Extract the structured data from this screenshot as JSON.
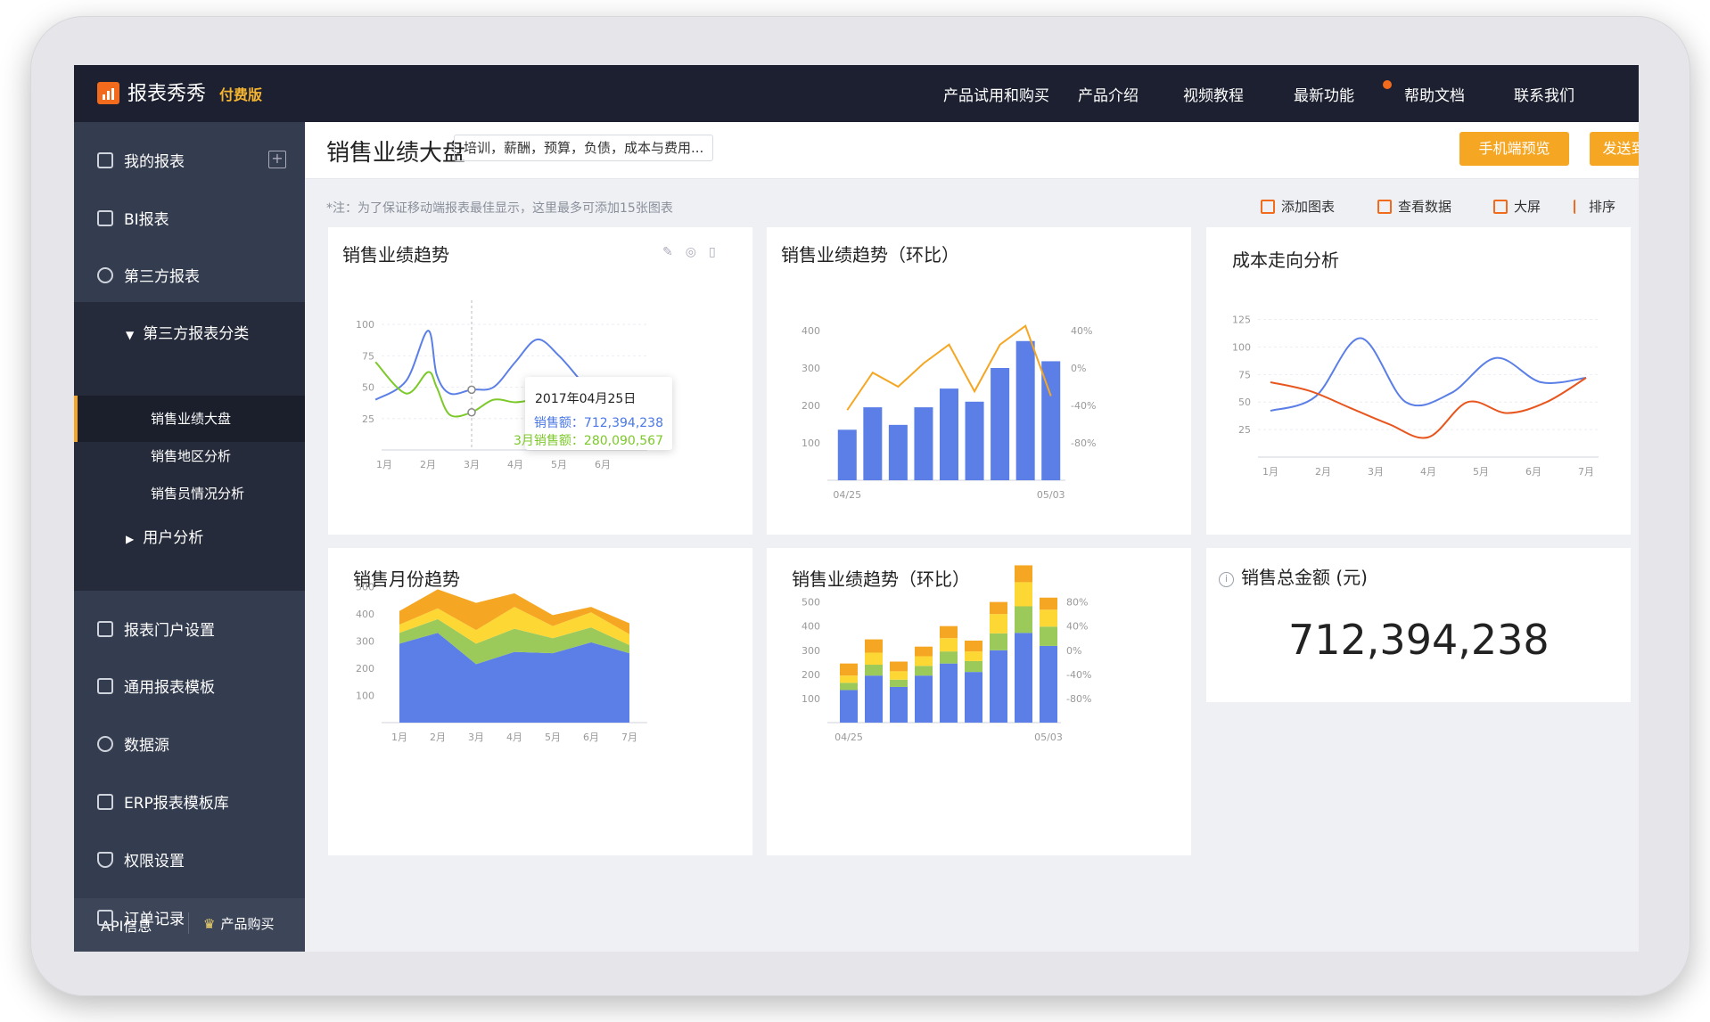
{
  "app": {
    "name": "报表秀秀",
    "edition": "付费版"
  },
  "nav": [
    "产品试用和购买",
    "产品介绍",
    "视频教程",
    "最新功能",
    "帮助文档",
    "联系我们"
  ],
  "sidebar": {
    "items": [
      {
        "label": "我的报表",
        "icon": "report-icon"
      },
      {
        "label": "BI报表",
        "icon": "cube-icon"
      },
      {
        "label": "第三方报表",
        "icon": "link-icon"
      },
      {
        "label": "报表门户设置",
        "icon": "portal-icon"
      },
      {
        "label": "通用报表模板",
        "icon": "template-icon"
      },
      {
        "label": "数据源",
        "icon": "pie-icon"
      },
      {
        "label": "ERP报表模板库",
        "icon": "grid-icon"
      },
      {
        "label": "权限设置",
        "icon": "shield-icon"
      },
      {
        "label": "订单记录",
        "icon": "clipboard-icon"
      }
    ],
    "sub_header": "第三方报表分类",
    "children": [
      "销售业绩大盘",
      "销售地区分析",
      "销售员情况分析"
    ],
    "user_analysis": "用户分析",
    "api": "API信息",
    "buy": "产品购买"
  },
  "header": {
    "title": "销售业绩大盘",
    "tags": "培训，薪酬，预算，负债，成本与费用...",
    "mobile_preview": "手机端预览",
    "send_mobile": "发送到手机端"
  },
  "notice": "*注：为了保证移动端报表最佳显示，这里最多可添加15张图表",
  "toolbar": {
    "add_chart": "添加图表",
    "view_data": "查看数据",
    "big_screen": "大屏",
    "sort": "排序"
  },
  "cards": {
    "c1": "销售业绩趋势",
    "c2": "销售业绩趋势（环比）",
    "c3": "成本走向分析",
    "c4": "销售月份趋势",
    "c5": "销售业绩趋势（环比）",
    "c6": "销售总金额 (元)"
  },
  "tooltip": {
    "date": "2017年04月25日",
    "line1": "销售额：712,394,238",
    "line2": "3月销售额：280,090,567"
  },
  "total_amount": "712,394,238",
  "colors": {
    "blue": "#5b7fe6",
    "green": "#7cc92a",
    "orange": "#f5a623",
    "red": "#e8561f",
    "yellow": "#fdd835",
    "lime": "#9bc95a",
    "accent": "#f5a623"
  },
  "chart_data": [
    {
      "type": "line",
      "title": "销售业绩趋势",
      "categories": [
        "1月",
        "2月",
        "3月",
        "4月",
        "5月",
        "6月"
      ],
      "x": [
        0.8,
        1.5,
        2.0,
        2.2,
        2.5,
        3.0,
        3.5,
        4.0,
        4.5,
        5.0,
        5.5
      ],
      "series": [
        {
          "values": [
            40,
            55,
            95,
            60,
            45,
            48,
            50,
            70,
            88,
            75,
            55
          ]
        },
        {
          "values": [
            70,
            45,
            62,
            50,
            28,
            30,
            40,
            38,
            40,
            38,
            36
          ]
        }
      ],
      "ylim": [
        0,
        110
      ],
      "yticks": [
        25,
        50,
        75,
        100
      ]
    },
    {
      "type": "bar",
      "title": "销售业绩趋势（环比）",
      "categories": [
        "04/25",
        "",
        "",
        "",
        "",
        "",
        "",
        "",
        "05/03"
      ],
      "values": [
        135,
        195,
        148,
        195,
        245,
        210,
        300,
        372,
        318
      ],
      "line": [
        -45,
        -5,
        -20,
        5,
        25,
        -25,
        25,
        45,
        -30
      ],
      "ylim": [
        0,
        450
      ],
      "yticks": [
        100,
        200,
        300,
        400
      ],
      "y2ticks": [
        "40%",
        "0%",
        "-40%",
        "-80%"
      ]
    },
    {
      "type": "line",
      "title": "成本走向分析",
      "categories": [
        "1月",
        "2月",
        "3月",
        "4月",
        "5月",
        "6月",
        "7月"
      ],
      "series": [
        {
          "values": [
            42,
            55,
            108,
            50,
            58,
            90,
            68,
            72
          ]
        },
        {
          "values": [
            68,
            60,
            45,
            30,
            18,
            50,
            40,
            50,
            72
          ]
        }
      ],
      "ylim": [
        0,
        140
      ],
      "yticks": [
        25,
        50,
        75,
        100,
        125
      ]
    },
    {
      "type": "area",
      "title": "销售月份趋势",
      "categories": [
        "1月",
        "2月",
        "3月",
        "4月",
        "5月",
        "6月",
        "7月"
      ],
      "series": [
        {
          "values": [
            290,
            330,
            215,
            260,
            255,
            295,
            255
          ]
        },
        {
          "values": [
            40,
            50,
            75,
            85,
            55,
            55,
            30
          ]
        },
        {
          "values": [
            30,
            40,
            50,
            80,
            45,
            55,
            40
          ]
        },
        {
          "values": [
            50,
            70,
            100,
            50,
            40,
            20,
            40
          ]
        }
      ],
      "ylim": [
        0,
        550
      ],
      "yticks": [
        100,
        200,
        300,
        400,
        500
      ]
    },
    {
      "type": "bar",
      "title": "销售业绩趋势（环比）",
      "categories": [
        "04/25",
        "",
        "",
        "",
        "",
        "",
        "",
        "",
        "05/03"
      ],
      "series": [
        {
          "values": [
            135,
            195,
            148,
            195,
            245,
            210,
            300,
            372,
            318
          ]
        },
        {
          "values": [
            30,
            45,
            30,
            40,
            50,
            45,
            70,
            110,
            80
          ]
        },
        {
          "values": [
            30,
            50,
            35,
            40,
            55,
            40,
            80,
            100,
            70
          ]
        },
        {
          "values": [
            50,
            55,
            40,
            40,
            50,
            45,
            50,
            70,
            50
          ]
        }
      ],
      "ylim": [
        0,
        650
      ],
      "yticks": [
        100,
        200,
        300,
        400,
        500
      ],
      "y2ticks": [
        "80%",
        "40%",
        "0%",
        "-40%",
        "-80%"
      ]
    }
  ]
}
